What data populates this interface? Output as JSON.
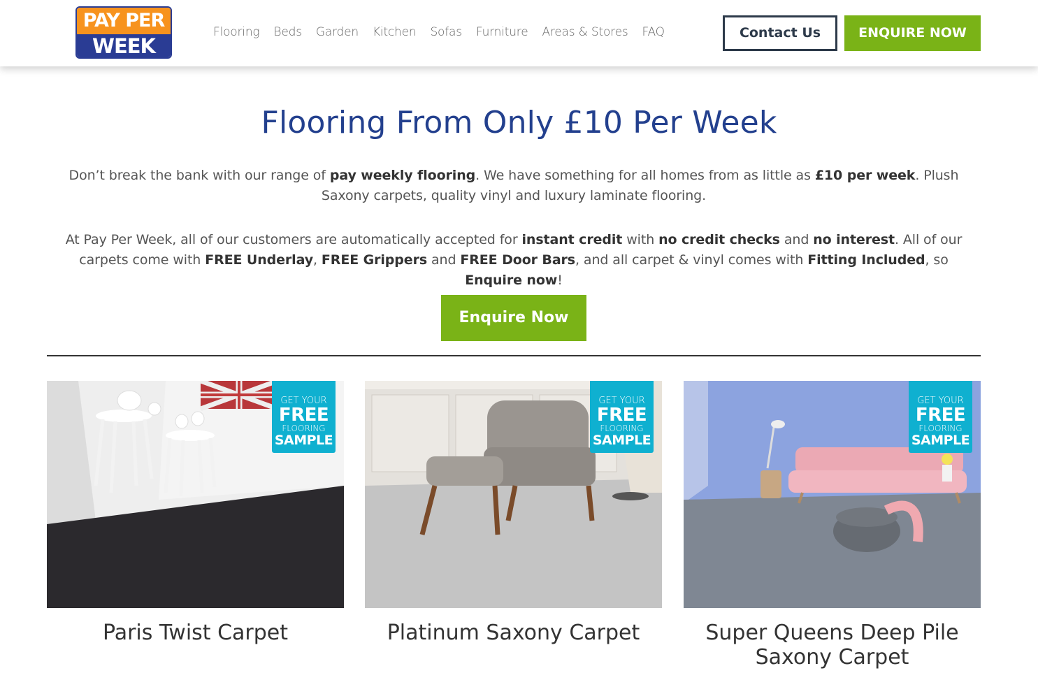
{
  "logo": {
    "line1": "PAY PER",
    "line2": "WEEK"
  },
  "nav": {
    "items": [
      "Flooring",
      "Beds",
      "Garden",
      "Kitchen",
      "Sofas",
      "Furniture",
      "Areas & Stores",
      "FAQ"
    ]
  },
  "header": {
    "contact_label": "Contact Us",
    "enquire_label": "ENQUIRE NOW"
  },
  "main": {
    "title": "Flooring From Only £10 Per Week",
    "para1": {
      "t1": "Don’t break the bank with our range of ",
      "b1": "pay weekly flooring",
      "t2": ". We have something for all homes from as little as ",
      "b2": "£10 per week",
      "t3": ". Plush Saxony carpets, quality vinyl and luxury laminate flooring."
    },
    "para2": {
      "t1": "At Pay Per Week, all of our customers are automatically accepted for ",
      "b1": "instant credit",
      "t2": " with ",
      "b2": "no credit checks",
      "t3": " and ",
      "b3": "no interest",
      "t4": ". All of our carpets come with ",
      "b4": "FREE Underlay",
      "t5": ", ",
      "b5": "FREE Grippers",
      "t6": " and ",
      "b6": "FREE Door Bars",
      "t7": ", and all carpet & vinyl comes with ",
      "b7": "Fitting Included",
      "t8": ", so ",
      "b8": "Enquire now",
      "t9": "!"
    },
    "enquire_label": "Enquire Now"
  },
  "badge": {
    "line1": "GET YOUR",
    "line2": "FREE",
    "line3": "FLOORING",
    "line4": "SAMPLE"
  },
  "products": [
    {
      "title": "Paris Twist Carpet"
    },
    {
      "title": "Platinum Saxony Carpet"
    },
    {
      "title": "Super Queens Deep Pile Saxony Carpet"
    }
  ],
  "colors": {
    "brand_blue": "#23408e",
    "brand_orange": "#f7931e",
    "accent_green": "#7ab317",
    "badge_cyan": "#0fb0d0"
  }
}
